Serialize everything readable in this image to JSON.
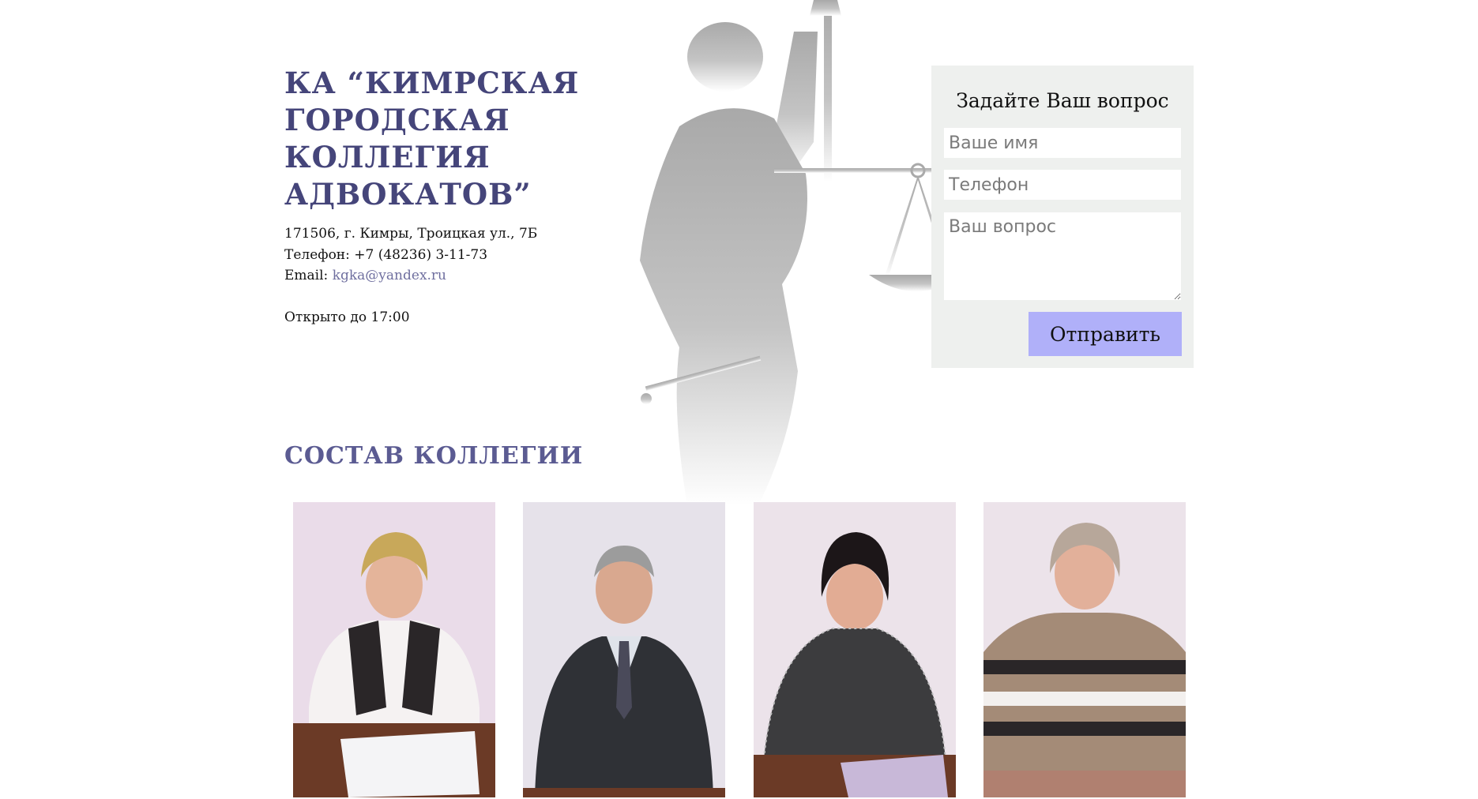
{
  "header": {
    "title": "КА “КИМРСКАЯ ГОРОДСКАЯ КОЛЛЕГИЯ АДВОКАТОВ”"
  },
  "contacts": {
    "address": "171506, г. Кимры, Троицкая ул., 7Б",
    "phone_label": "Телефон:",
    "phone": "+7 (48236) 3-11-73",
    "email_label": "Email:",
    "email": "kgka@yandex.ru",
    "hours": "Открыто до 17:00"
  },
  "question_form": {
    "title": "Задайте Ваш вопрос",
    "name_placeholder": "Ваше имя",
    "phone_placeholder": "Телефон",
    "question_placeholder": "Ваш вопрос",
    "submit_label": "Отправить"
  },
  "members_section": {
    "title": "СОСТАВ КОЛЛЕГИИ"
  },
  "colors": {
    "title": "#45457a",
    "section_title": "#5b5b92",
    "link": "#6f6f9f",
    "form_bg": "#eef0ee",
    "button": "#b0b0f9"
  }
}
